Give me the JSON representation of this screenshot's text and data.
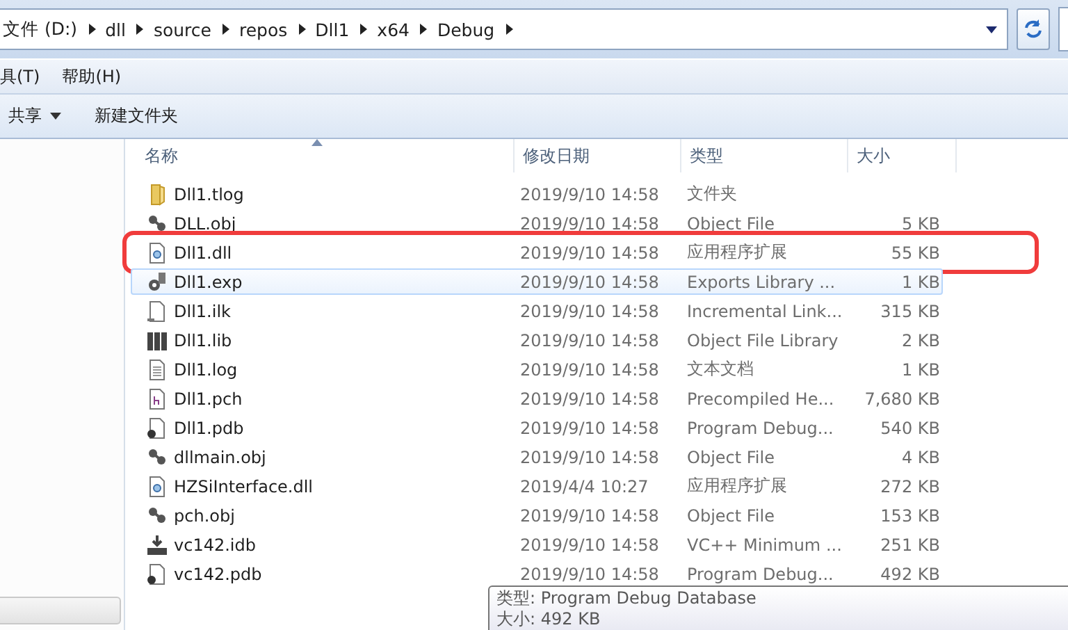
{
  "address_bar": {
    "crumbs": [
      "文件 (D:)",
      "dll",
      "source",
      "repos",
      "Dll1",
      "x64",
      "Debug"
    ]
  },
  "menu_bar": {
    "items": [
      "具(T)",
      "帮助(H)"
    ]
  },
  "toolbar": {
    "items": [
      {
        "label": "共享",
        "dropdown": true
      },
      {
        "label": "新建文件夹",
        "dropdown": false
      }
    ]
  },
  "table": {
    "columns": [
      "名称",
      "修改日期",
      "类型",
      "大小"
    ],
    "rows": [
      {
        "kind": "folder",
        "name": "Dll1.tlog",
        "date": "2019/9/10 14:58",
        "type": "文件夹",
        "size": "",
        "hovered": false,
        "highlighted": false
      },
      {
        "kind": "object",
        "name": "DLL.obj",
        "date": "2019/9/10 14:58",
        "type": "Object File",
        "size": "5 KB",
        "hovered": false,
        "highlighted": false
      },
      {
        "kind": "extension",
        "name": "Dll1.dll",
        "date": "2019/9/10 14:58",
        "type": "应用程序扩展",
        "size": "55 KB",
        "hovered": false,
        "highlighted": true
      },
      {
        "kind": "exports",
        "name": "Dll1.exp",
        "date": "2019/9/10 14:58",
        "type": "Exports Library ...",
        "size": "1 KB",
        "hovered": true,
        "highlighted": false
      },
      {
        "kind": "incremental",
        "name": "Dll1.ilk",
        "date": "2019/9/10 14:58",
        "type": "Incremental Link...",
        "size": "315 KB",
        "hovered": false,
        "highlighted": false
      },
      {
        "kind": "library",
        "name": "Dll1.lib",
        "date": "2019/9/10 14:58",
        "type": "Object File Library",
        "size": "2 KB",
        "hovered": false,
        "highlighted": false
      },
      {
        "kind": "text",
        "name": "Dll1.log",
        "date": "2019/9/10 14:58",
        "type": "文本文档",
        "size": "1 KB",
        "hovered": false,
        "highlighted": false
      },
      {
        "kind": "header",
        "name": "Dll1.pch",
        "date": "2019/9/10 14:58",
        "type": "Precompiled He...",
        "size": "7,680 KB",
        "hovered": false,
        "highlighted": false
      },
      {
        "kind": "debug",
        "name": "Dll1.pdb",
        "date": "2019/9/10 14:58",
        "type": "Program Debug...",
        "size": "540 KB",
        "hovered": false,
        "highlighted": false
      },
      {
        "kind": "object",
        "name": "dllmain.obj",
        "date": "2019/9/10 14:58",
        "type": "Object File",
        "size": "4 KB",
        "hovered": false,
        "highlighted": false
      },
      {
        "kind": "extension",
        "name": "HZSiInterface.dll",
        "date": "2019/4/4 10:27",
        "type": "应用程序扩展",
        "size": "272 KB",
        "hovered": false,
        "highlighted": false
      },
      {
        "kind": "object",
        "name": "pch.obj",
        "date": "2019/9/10 14:58",
        "type": "Object File",
        "size": "153 KB",
        "hovered": false,
        "highlighted": false
      },
      {
        "kind": "database",
        "name": "vc142.idb",
        "date": "2019/9/10 14:58",
        "type": "VC++ Minimum ...",
        "size": "251 KB",
        "hovered": false,
        "highlighted": false
      },
      {
        "kind": "debug",
        "name": "vc142.pdb",
        "date": "2019/9/10 14:58",
        "type": "Program Debug...",
        "size": "492 KB",
        "hovered": false,
        "highlighted": false
      }
    ]
  },
  "tooltip": {
    "lines": [
      "类型: Program Debug Database",
      "大小: 492 KB"
    ]
  }
}
